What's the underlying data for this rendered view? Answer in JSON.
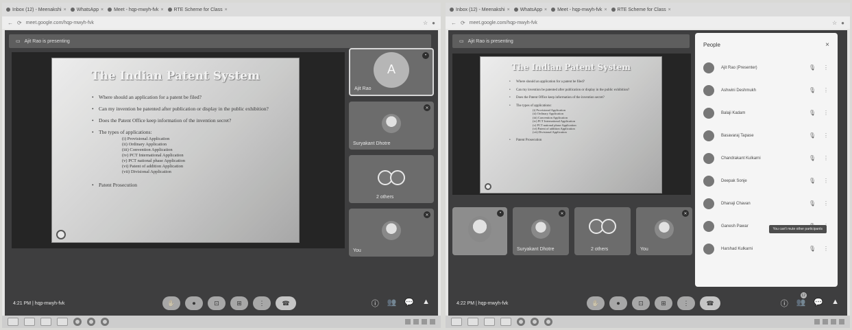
{
  "left": {
    "tabs": [
      {
        "label": "Inbox (12) - Meenakshi",
        "close": "×"
      },
      {
        "label": "WhatsApp",
        "close": "×"
      },
      {
        "label": "Meet - hqp-mwyh-fvk",
        "close": "×"
      },
      {
        "label": "RTE Scheme for Class",
        "close": "×"
      }
    ],
    "url": "meet.google.com/hqp-mwyh-fvk",
    "presenting": "Ajit Rao is presenting",
    "slide": {
      "title": "The Indian Patent System",
      "bullets": [
        "Where should an application for a patent be filed?",
        "Can my invention be patented after publication or display in the public exhibition?",
        "Does the Patent Office keep information of the invention secret?",
        "The types of applications:"
      ],
      "sub": [
        "(i) Provisional Application",
        "(ii) Ordinary Application",
        "(iii) Convention Application",
        "(iv) PCT International Application",
        "(v) PCT national phase Application",
        "(vi) Patent of addition Application",
        "(vii) Divisional Application"
      ],
      "last": "Patent Prosecution"
    },
    "tiles": [
      {
        "name": "Ajit Rao",
        "initial": "A"
      },
      {
        "name": "Suryakant Dhotre"
      },
      {
        "name": "2 others"
      },
      {
        "name": "You"
      }
    ],
    "meta": "4:21 PM  |  hqp-mwyh-fvk",
    "controls": [
      "✋",
      "⏺",
      "⊡",
      "⊞",
      "⋮",
      "☎"
    ],
    "side_controls": [
      "ⓘ",
      "👥",
      "💬",
      "▲"
    ]
  },
  "right": {
    "tabs": [
      {
        "label": "Inbox (12) - Meenakshi",
        "close": "×"
      },
      {
        "label": "WhatsApp",
        "close": "×"
      },
      {
        "label": "Meet - hqp-mwyh-fvk",
        "close": "×"
      },
      {
        "label": "RTE Scheme for Class",
        "close": "×"
      }
    ],
    "url": "meet.google.com/hqp-mwyh-fvk",
    "presenting": "Ajit Rao is presenting",
    "slide": {
      "title": "The Indian Patent System",
      "bullets": [
        "Where should an application for a patent be filed?",
        "Can my invention be patented after publication or display in the public exhibition?",
        "Does the Patent Office keep information of the invention secret?",
        "The types of applications:"
      ],
      "sub": [
        "(i) Provisional Application",
        "(ii) Ordinary Application",
        "(iii) Convention Application",
        "(iv) PCT International Application",
        "(v) PCT national phase Application",
        "(vi) Patent of addition Application",
        "(vii) Divisional Application"
      ],
      "last": "Patent Prosecution"
    },
    "tiles": [
      {
        "name": ""
      },
      {
        "name": "Suryakant Dhotre"
      },
      {
        "name": "2 others"
      },
      {
        "name": "You"
      }
    ],
    "people_title": "People",
    "people": [
      {
        "name": "Ajit Rao (Presenter)"
      },
      {
        "name": "Ashwini Deshmukh"
      },
      {
        "name": "Balaji Kadam"
      },
      {
        "name": "Basavaraj Tapase"
      },
      {
        "name": "Chandrakant Kulkarni"
      },
      {
        "name": "Deepak Sonje"
      },
      {
        "name": "Dhanaji Chavan"
      },
      {
        "name": "Ganesh Pawar"
      },
      {
        "name": "Harshad Kulkarni"
      }
    ],
    "tooltip": "You can't mute other participants",
    "meta": "4:22 PM  |  hqp-mwyh-fvk",
    "controls": [
      "✋",
      "⏺",
      "⊡",
      "⊞",
      "⋮",
      "☎"
    ],
    "side_controls": [
      "ⓘ",
      "👥",
      "💬",
      "▲"
    ],
    "badge": "12"
  }
}
